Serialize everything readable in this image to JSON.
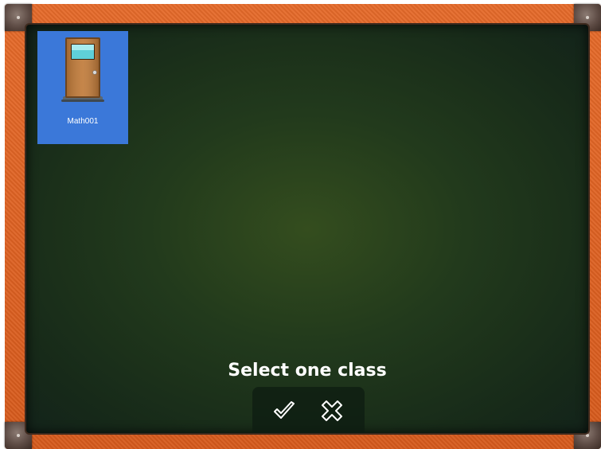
{
  "classes": [
    {
      "label": "Math001",
      "icon": "door-icon"
    }
  ],
  "prompt": "Select one class",
  "actions": {
    "confirm_icon": "checkmark-icon",
    "cancel_icon": "close-x-icon"
  },
  "colors": {
    "frame": "#e0642a",
    "board": "#223a1c",
    "tile_selected": "#3b78d9"
  }
}
